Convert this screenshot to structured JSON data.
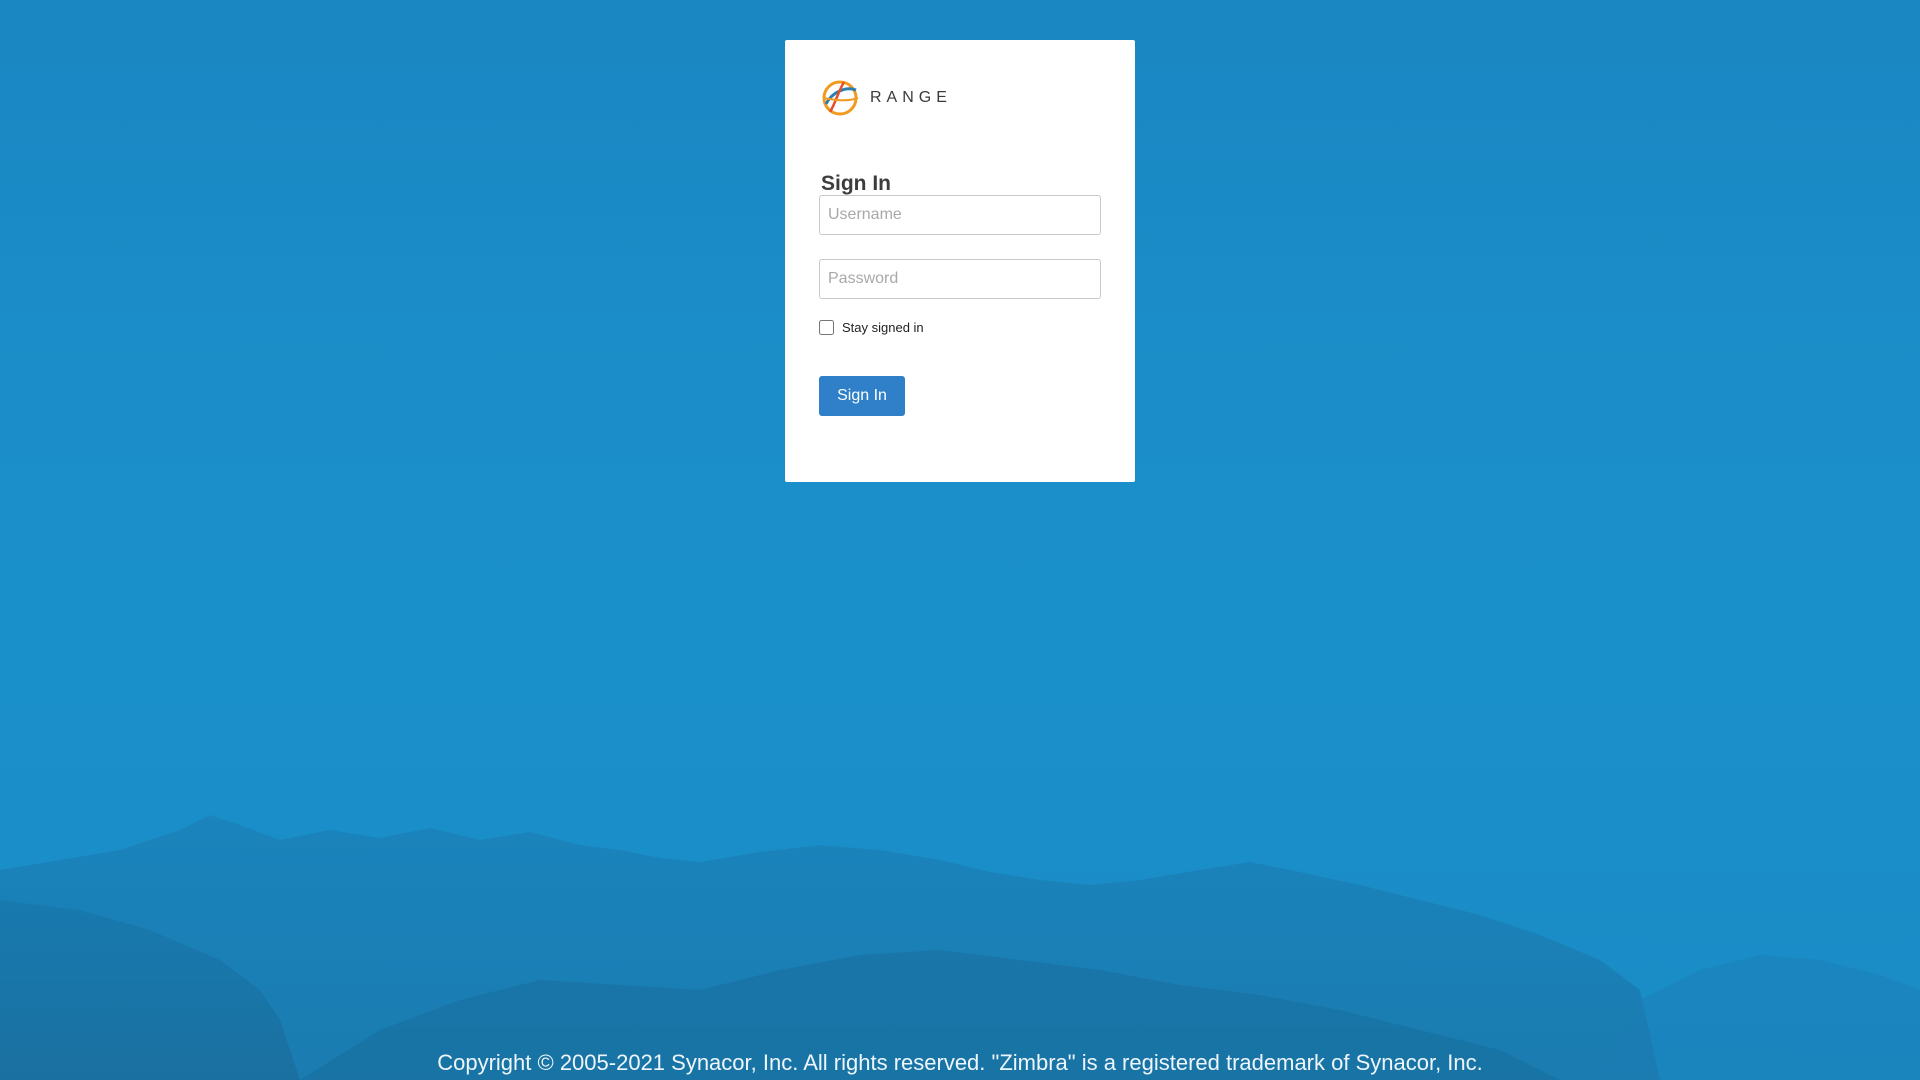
{
  "brand": {
    "name": "RANGE",
    "logo_icon": "range-globe-icon",
    "logo_colors": [
      "#f29a1f",
      "#2a7fb0",
      "#e94e24"
    ]
  },
  "login": {
    "title": "Sign In",
    "username_placeholder": "Username",
    "password_placeholder": "Password",
    "stay_signed_in_label": "Stay signed in",
    "submit_label": "Sign In"
  },
  "footer": {
    "copyright": "Copyright © 2005-2021 Synacor, Inc. All rights reserved. \"Zimbra\" is a registered trademark of Synacor, Inc."
  },
  "colors": {
    "background": "#1a8ec9",
    "button": "#2f80c8",
    "card": "#ffffff"
  }
}
